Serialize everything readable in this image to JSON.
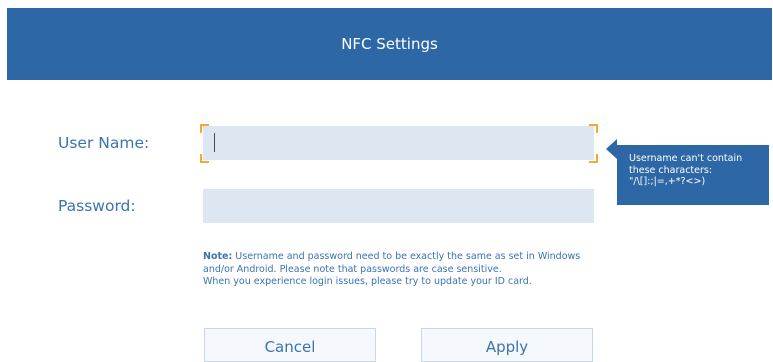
{
  "header": {
    "title": "NFC Settings"
  },
  "form": {
    "username": {
      "label": "User Name:",
      "value": ""
    },
    "password": {
      "label": "Password:",
      "value": ""
    }
  },
  "tooltip": {
    "lines": [
      "Username can't contain",
      "these characters:",
      "\"/\\[]:;|=,+*?<>)"
    ]
  },
  "note": {
    "prefix": "Note:",
    "line1": " Username and password need to be exactly the same as set in Windows",
    "line2": "and/or Android. Please note that passwords are case sensitive.",
    "line3": "When you experience login issues, please try to update your ID card."
  },
  "buttons": {
    "cancel": "Cancel",
    "apply": "Apply"
  },
  "colors": {
    "header_bg": "#2d67a6",
    "label_text": "#3b73b1",
    "field_bg": "#dde7f2",
    "focus_corners": "#f2a93a"
  }
}
